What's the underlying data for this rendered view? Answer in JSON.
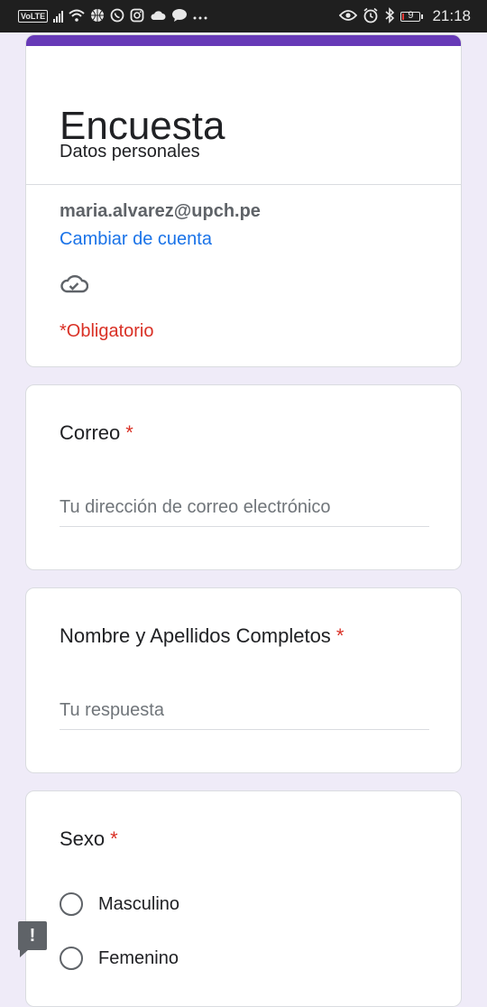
{
  "status_bar": {
    "volte_label": "VoLTE",
    "battery_level": "9",
    "time": "21:18",
    "icons": [
      "signal-icon",
      "wifi-icon",
      "basketball-icon",
      "whatsapp-icon",
      "instagram-icon",
      "cloud-icon",
      "message-icon",
      "more-icon",
      "eye-icon",
      "alarm-icon",
      "bluetooth-icon",
      "battery-icon"
    ]
  },
  "form": {
    "accent_color": "#673ab7",
    "title": "Encuesta",
    "description": "Datos personales",
    "account_email": "maria.alvarez@upch.pe",
    "switch_account": "Cambiar de cuenta",
    "required_note": "*Obligatorio"
  },
  "questions": [
    {
      "label": "Correo",
      "required_mark": "*",
      "placeholder": "Tu dirección de correo electrónico"
    },
    {
      "label": "Nombre y Apellidos Completos",
      "required_mark": "*",
      "placeholder": "Tu respuesta"
    },
    {
      "label": "Sexo",
      "required_mark": "*",
      "options": [
        "Masculino",
        "Femenino"
      ]
    }
  ],
  "report_button": {
    "glyph": "!"
  }
}
